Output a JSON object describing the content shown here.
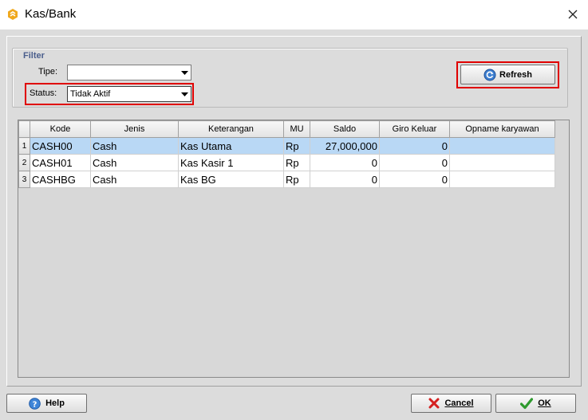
{
  "window": {
    "title": "Kas/Bank"
  },
  "filter": {
    "legend": "Filter",
    "tipe_label": "Tipe:",
    "tipe_value": "",
    "status_label": "Status:",
    "status_value": "Tidak Aktif"
  },
  "toolbar": {
    "refresh_label": "Refresh"
  },
  "table": {
    "columns": [
      "Kode",
      "Jenis",
      "Keterangan",
      "MU",
      "Saldo",
      "Giro Keluar",
      "Opname karyawan"
    ],
    "rows": [
      {
        "num": "1",
        "kode": "CASH00",
        "jenis": "Cash",
        "keterangan": "Kas Utama",
        "mu": "Rp",
        "saldo": "27,000,000",
        "giro": "0",
        "opname": ""
      },
      {
        "num": "2",
        "kode": "CASH01",
        "jenis": "Cash",
        "keterangan": "Kas Kasir 1",
        "mu": "Rp",
        "saldo": "0",
        "giro": "0",
        "opname": ""
      },
      {
        "num": "3",
        "kode": "CASHBG",
        "jenis": "Cash",
        "keterangan": "Kas BG",
        "mu": "Rp",
        "saldo": "0",
        "giro": "0",
        "opname": ""
      }
    ]
  },
  "footer": {
    "help_label": "Help",
    "cancel_label": "Cancel",
    "ok_label": "OK"
  },
  "icons": {
    "app": "app-logo-icon",
    "close": "close-icon",
    "refresh": "refresh-icon",
    "help": "help-icon",
    "cancel": "cancel-x-icon",
    "ok": "checkmark-icon"
  },
  "colors": {
    "highlight": "#e00000",
    "selected_row": "#b9d8f5",
    "client_bg": "#dcdcdc"
  }
}
